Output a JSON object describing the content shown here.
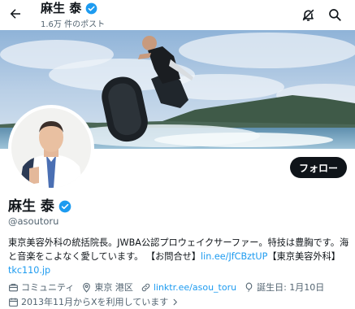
{
  "header": {
    "name": "麻生 泰",
    "post_count": "1.6万 件のポスト"
  },
  "profile": {
    "name": "麻生 泰",
    "handle": "@asoutoru",
    "follow_label": "フォロー",
    "bio": {
      "text1": "東京美容外科の統括院長。JWBA公認プロウェイクサーファー。特技は豊胸です。海と音楽をこよなく愛しています。 【お問合せ】",
      "link1": "lin.ee/JfCBztUP",
      "text2": "【東京美容外科】",
      "link2": "tkc110.jp"
    },
    "meta": {
      "community": "コミュニティ",
      "location": "東京 港区",
      "website": "linktr.ee/asou_toru",
      "birthday": "誕生日: 1月10日",
      "joined": "2013年11月からXを利用しています"
    }
  },
  "colors": {
    "accent": "#1d9bf0",
    "verified": "#1d9bf0",
    "text_primary": "#0f1419",
    "text_secondary": "#536471"
  }
}
